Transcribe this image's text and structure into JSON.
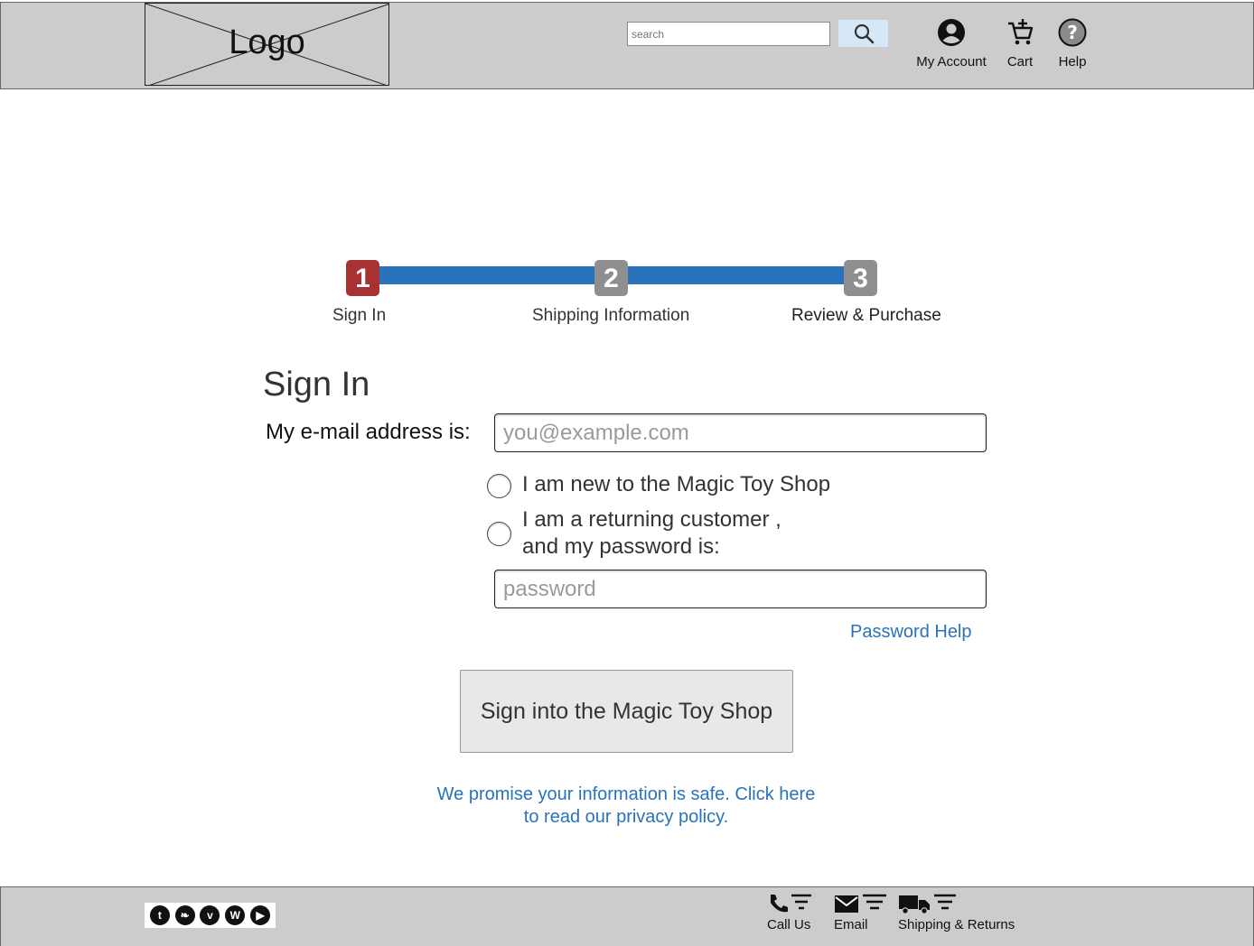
{
  "header": {
    "logo_text": "Logo",
    "search_placeholder": "search",
    "nav": {
      "account": "My Account",
      "cart": "Cart",
      "help": "Help"
    }
  },
  "progress": {
    "steps": [
      {
        "number": "1",
        "label": "Sign In",
        "state": "active"
      },
      {
        "number": "2",
        "label": "Shipping Information",
        "state": "inactive"
      },
      {
        "number": "3",
        "label": "Review & Purchase",
        "state": "inactive"
      }
    ]
  },
  "form": {
    "title": "Sign In",
    "email_label": "My e-mail address is:",
    "email_placeholder": "you@example.com",
    "option_new": "I am new to the Magic Toy Shop",
    "option_returning_line1": "I am a returning customer ,",
    "option_returning_line2": "and my password is:",
    "password_placeholder": "password",
    "password_help": "Password Help",
    "submit": "Sign into the Magic Toy Shop",
    "privacy_line1": "We promise your information is safe. Click here",
    "privacy_line2": "to read our privacy policy."
  },
  "footer": {
    "social": [
      {
        "icon": "tumblr-icon",
        "glyph": "t"
      },
      {
        "icon": "twitter-icon",
        "glyph": "❧"
      },
      {
        "icon": "vimeo-icon",
        "glyph": "v"
      },
      {
        "icon": "wordpress-icon",
        "glyph": "W"
      },
      {
        "icon": "youtube-icon",
        "glyph": "▶"
      }
    ],
    "call": "Call Us",
    "email": "Email",
    "shipping": "Shipping & Returns"
  },
  "colors": {
    "accent": "#2a72bb",
    "active_step": "#a83232",
    "inactive_step": "#8f8f8f",
    "chrome": "#cccccc"
  }
}
